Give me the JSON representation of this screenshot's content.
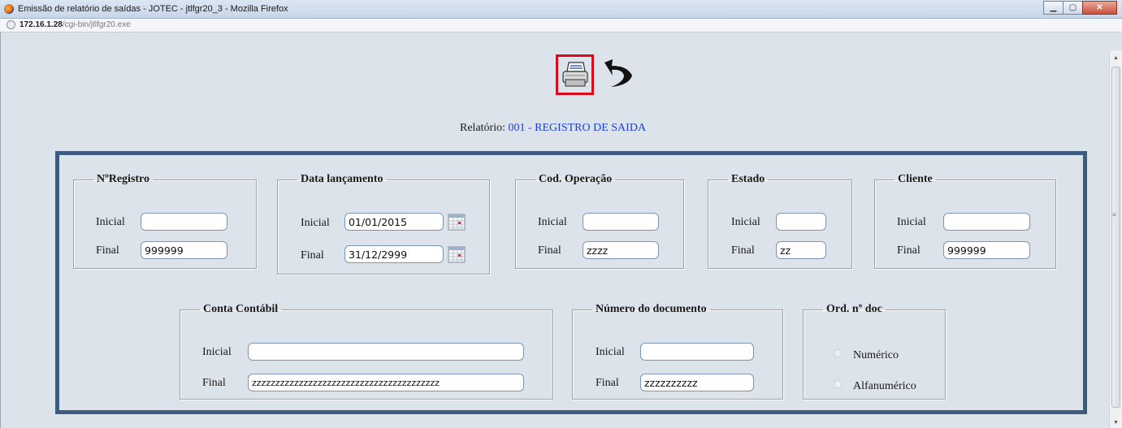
{
  "window": {
    "title": "Emissão de relatório de saídas - JOTEC - jtlfgr20_3 - Mozilla Firefox",
    "url_host": "172.16.1.28",
    "url_path": "/cgi-bin/jtlfgr20.exe",
    "buttons": {
      "minimize": "▁",
      "maximize": "▢",
      "close": "✕"
    }
  },
  "toolbar": {
    "print_icon": "printer-icon",
    "back_icon": "return-arrow-icon"
  },
  "report": {
    "label": "Relatório:",
    "value": "001 - REGISTRO DE SAIDA"
  },
  "groups": {
    "registro": {
      "legend": "NºRegistro",
      "inicial_label": "Inicial",
      "final_label": "Final",
      "inicial_value": "",
      "final_value": "999999"
    },
    "data": {
      "legend": "Data lançamento",
      "inicial_label": "Inicial",
      "final_label": "Final",
      "inicial_value": "01/01/2015",
      "final_value": "31/12/2999"
    },
    "operacao": {
      "legend": "Cod. Operação",
      "inicial_label": "Inicial",
      "final_label": "Final",
      "inicial_value": "",
      "final_value": "zzzz"
    },
    "estado": {
      "legend": "Estado",
      "inicial_label": "Inicial",
      "final_label": "Final",
      "inicial_value": "",
      "final_value": "zz"
    },
    "cliente": {
      "legend": "Cliente",
      "inicial_label": "Inicial",
      "final_label": "Final",
      "inicial_value": "",
      "final_value": "999999"
    },
    "conta": {
      "legend": "Conta Contábil",
      "inicial_label": "Inicial",
      "final_label": "Final",
      "inicial_value": "",
      "final_value": "zzzzzzzzzzzzzzzzzzzzzzzzzzzzzzzzzzzzzzzz"
    },
    "documento": {
      "legend": "Número do documento",
      "inicial_label": "Inicial",
      "final_label": "Final",
      "inicial_value": "",
      "final_value": "zzzzzzzzzz"
    },
    "ordem": {
      "legend": "Ord. nº doc",
      "option1": "Numérico",
      "option2": "Alfanumérico"
    }
  }
}
